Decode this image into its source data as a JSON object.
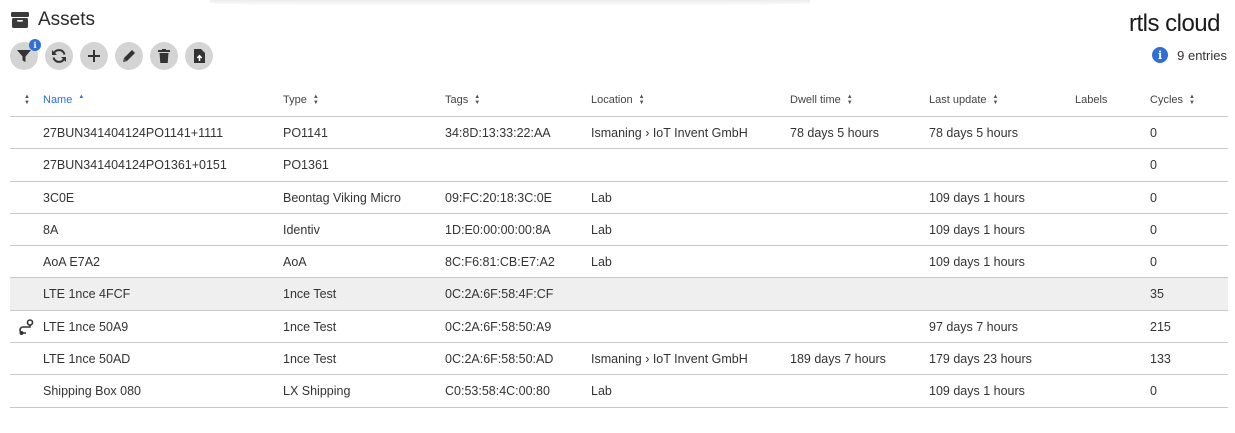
{
  "page": {
    "title": "Assets",
    "icon": "box-icon"
  },
  "brand": {
    "logo_text": "rtls cloud"
  },
  "toolbar": {
    "buttons": [
      {
        "name": "filter-button",
        "icon": "filter-icon",
        "badge": "i"
      },
      {
        "name": "refresh-button",
        "icon": "refresh-icon"
      },
      {
        "name": "add-button",
        "icon": "plus-icon"
      },
      {
        "name": "edit-button",
        "icon": "pencil-icon"
      },
      {
        "name": "delete-button",
        "icon": "trash-icon"
      },
      {
        "name": "export-button",
        "icon": "file-upload-icon"
      }
    ]
  },
  "entries": {
    "count_text": "9 entries",
    "icon": "info-icon"
  },
  "colors": {
    "accent": "#2f6fd6",
    "button_bg": "#d4d4d4",
    "row_highlight": "#efefef"
  },
  "table": {
    "columns": [
      {
        "key": "icon",
        "label": "",
        "sortable": true
      },
      {
        "key": "name",
        "label": "Name",
        "sortable": true,
        "active": true,
        "direction": "asc"
      },
      {
        "key": "type",
        "label": "Type",
        "sortable": true
      },
      {
        "key": "tags",
        "label": "Tags",
        "sortable": true
      },
      {
        "key": "location",
        "label": "Location",
        "sortable": true
      },
      {
        "key": "dwell",
        "label": "Dwell time",
        "sortable": true
      },
      {
        "key": "last_update",
        "label": "Last update",
        "sortable": true
      },
      {
        "key": "labels",
        "label": "Labels",
        "sortable": false
      },
      {
        "key": "cycles",
        "label": "Cycles",
        "sortable": true
      }
    ],
    "rows": [
      {
        "name": "27BUN341404124PO1141+1111",
        "type": "PO1141",
        "tags": "34:8D:13:33:22:AA",
        "location": "Ismaning › IoT Invent GmbH",
        "dwell": "78 days 5 hours",
        "last_update": "78 days 5 hours",
        "labels": "",
        "cycles": "0"
      },
      {
        "name": "27BUN341404124PO1361+0151",
        "type": "PO1361",
        "tags": "",
        "location": "",
        "dwell": "",
        "last_update": "",
        "labels": "",
        "cycles": "0"
      },
      {
        "name": "3C0E",
        "type": "Beontag Viking Micro",
        "tags": "09:FC:20:18:3C:0E",
        "location": "Lab",
        "dwell": "",
        "last_update": "109 days 1 hours",
        "labels": "",
        "cycles": "0"
      },
      {
        "name": "8A",
        "type": "Identiv",
        "tags": "1D:E0:00:00:00:8A",
        "location": "Lab",
        "dwell": "",
        "last_update": "109 days 1 hours",
        "labels": "",
        "cycles": "0"
      },
      {
        "name": "AoA E7A2",
        "type": "AoA",
        "tags": "8C:F6:81:CB:E7:A2",
        "location": "Lab",
        "dwell": "",
        "last_update": "109 days 1 hours",
        "labels": "",
        "cycles": "0"
      },
      {
        "name": "LTE 1nce 4FCF",
        "type": "1nce Test",
        "tags": "0C:2A:6F:58:4F:CF",
        "location": "",
        "dwell": "",
        "last_update": "",
        "labels": "",
        "cycles": "35",
        "highlight": true
      },
      {
        "name": "LTE 1nce 50A9",
        "type": "1nce Test",
        "tags": "0C:2A:6F:58:50:A9",
        "location": "",
        "dwell": "",
        "last_update": "97 days 7 hours",
        "labels": "",
        "cycles": "215",
        "icon": "route-icon"
      },
      {
        "name": "LTE 1nce 50AD",
        "type": "1nce Test",
        "tags": "0C:2A:6F:58:50:AD",
        "location": "Ismaning › IoT Invent GmbH",
        "dwell": "189 days 7 hours",
        "last_update": "179 days 23 hours",
        "labels": "",
        "cycles": "133"
      },
      {
        "name": "Shipping Box 080",
        "type": "LX Shipping",
        "tags": "C0:53:58:4C:00:80",
        "location": "Lab",
        "dwell": "",
        "last_update": "109 days 1 hours",
        "labels": "",
        "cycles": "0"
      }
    ]
  }
}
